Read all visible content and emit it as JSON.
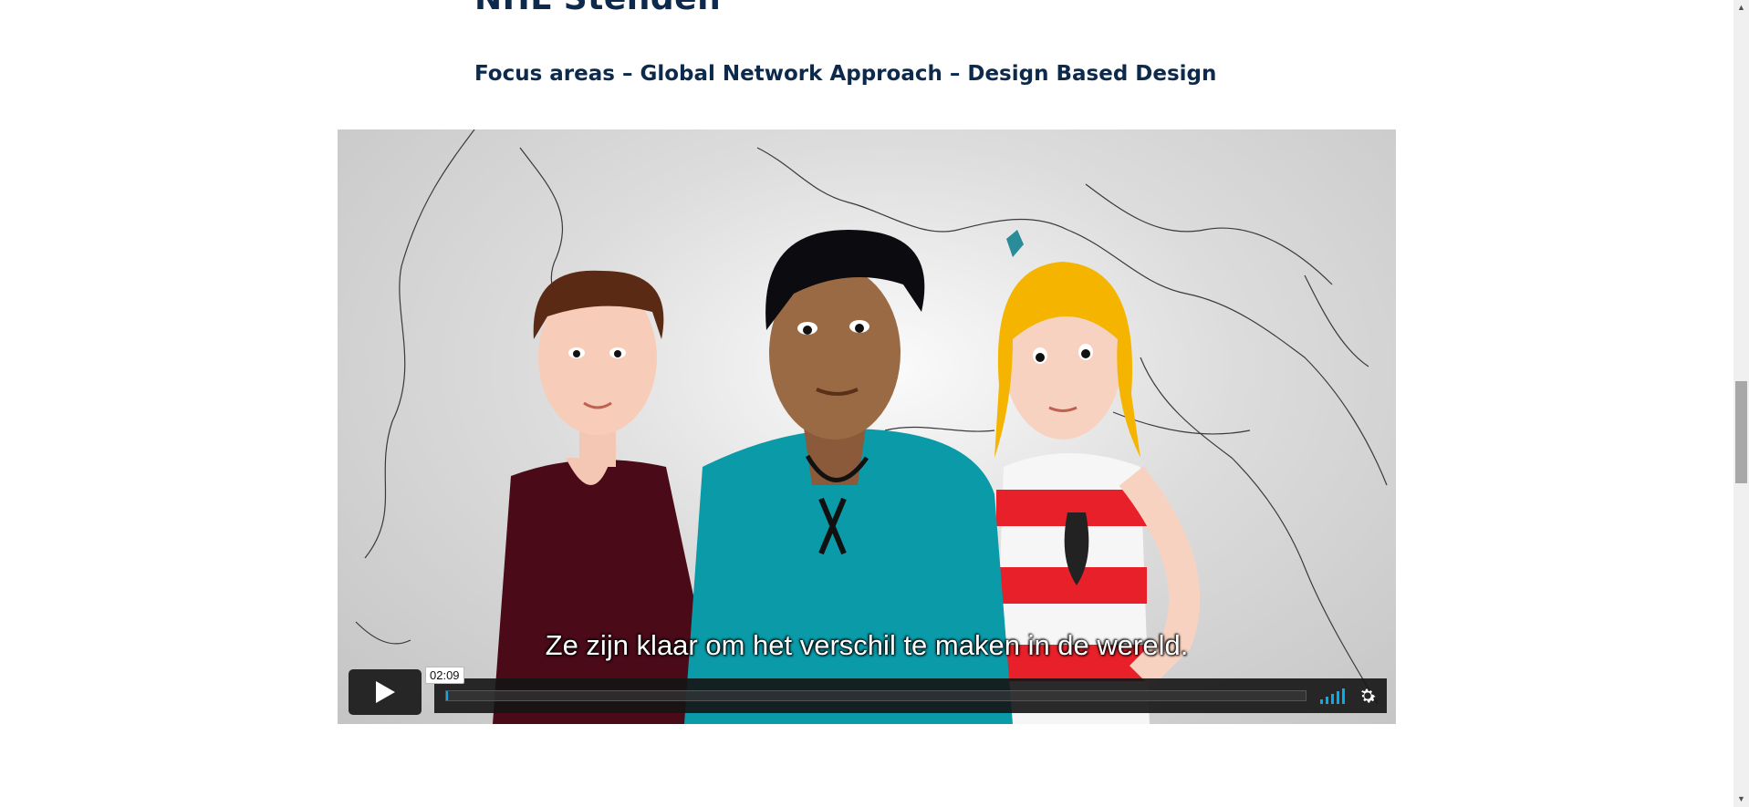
{
  "page": {
    "title": "NHL Stenden",
    "subtitle": "Focus areas – Global Network Approach – Design Based Design"
  },
  "video": {
    "caption": "Ze zijn klaar om het verschil te maken in de wereld.",
    "hover_time": "02:09",
    "progress_fraction": 0.001,
    "volume_level": "full",
    "accent_color": "#00adef"
  },
  "scrollbar": {
    "up_arrow": "▲",
    "down_arrow": "▼"
  }
}
